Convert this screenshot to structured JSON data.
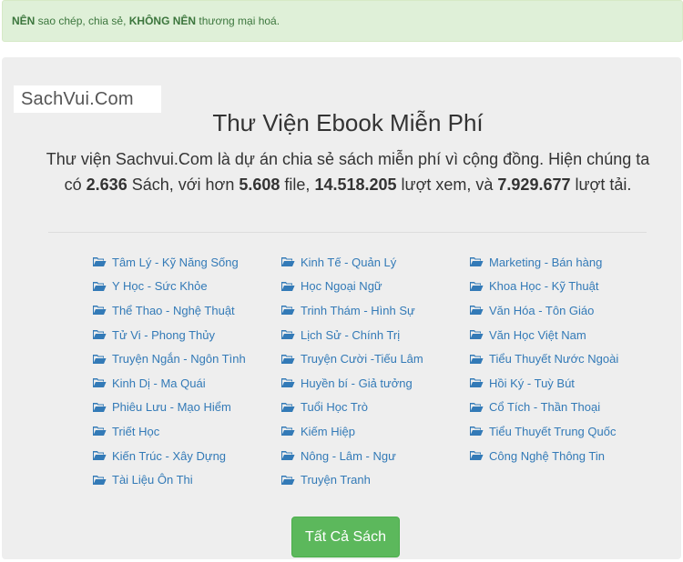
{
  "notice": {
    "part1_bold": "NÊN",
    "part2": " sao chép, chia sẻ, ",
    "part3_bold": "KHÔNG NÊN",
    "part4": " thương mại hoá."
  },
  "logo": {
    "text": "SachVui.Com"
  },
  "header": {
    "title": "Thư Viện Ebook Miễn Phí",
    "desc": {
      "t1": "Thư viện Sachvui.Com là dự án chia sẻ sách miễn phí vì cộng đồng. Hiện chúng ta có ",
      "books": "2.636",
      "t2": " Sách, với hơn ",
      "files": "5.608",
      "t3": " file, ",
      "views": "14.518.205",
      "t4": " lượt xem, và ",
      "downloads": "7.929.677",
      "t5": " lượt tải."
    }
  },
  "categories": {
    "col1": [
      "Tâm Lý - Kỹ Năng Sống",
      "Y Học - Sức Khỏe",
      "Thể Thao - Nghệ Thuật",
      "Tử Vi - Phong Thủy",
      "Truyện Ngắn - Ngôn Tình",
      "Kinh Dị - Ma Quái",
      "Phiêu Lưu - Mạo Hiểm",
      "Triết Học",
      "Kiến Trúc - Xây Dựng",
      "Tài Liệu Ôn Thi"
    ],
    "col2": [
      "Kinh Tế - Quản Lý",
      "Học Ngoại Ngữ",
      "Trinh Thám - Hình Sự",
      "Lịch Sử - Chính Trị",
      "Truyện Cười -Tiếu Lâm",
      "Huyền bí - Giả tưởng",
      "Tuổi Học Trò",
      "Kiếm Hiệp",
      "Nông - Lâm - Ngư",
      "Truyện Tranh"
    ],
    "col3": [
      "Marketing - Bán hàng",
      "Khoa Học - Kỹ Thuật",
      "Văn Hóa - Tôn Giáo",
      "Văn Học Việt Nam",
      "Tiểu Thuyết Nước Ngoài",
      "Hồi Ký - Tuỳ Bút",
      "Cổ Tích - Thần Thoại",
      "Tiểu Thuyết Trung Quốc",
      "Công Nghệ Thông Tin"
    ],
    "icon": "folder-open-icon",
    "link_color": "#337ab7"
  },
  "all_books_button": {
    "label": "Tất Cả Sách",
    "color": "#5cb85c"
  }
}
